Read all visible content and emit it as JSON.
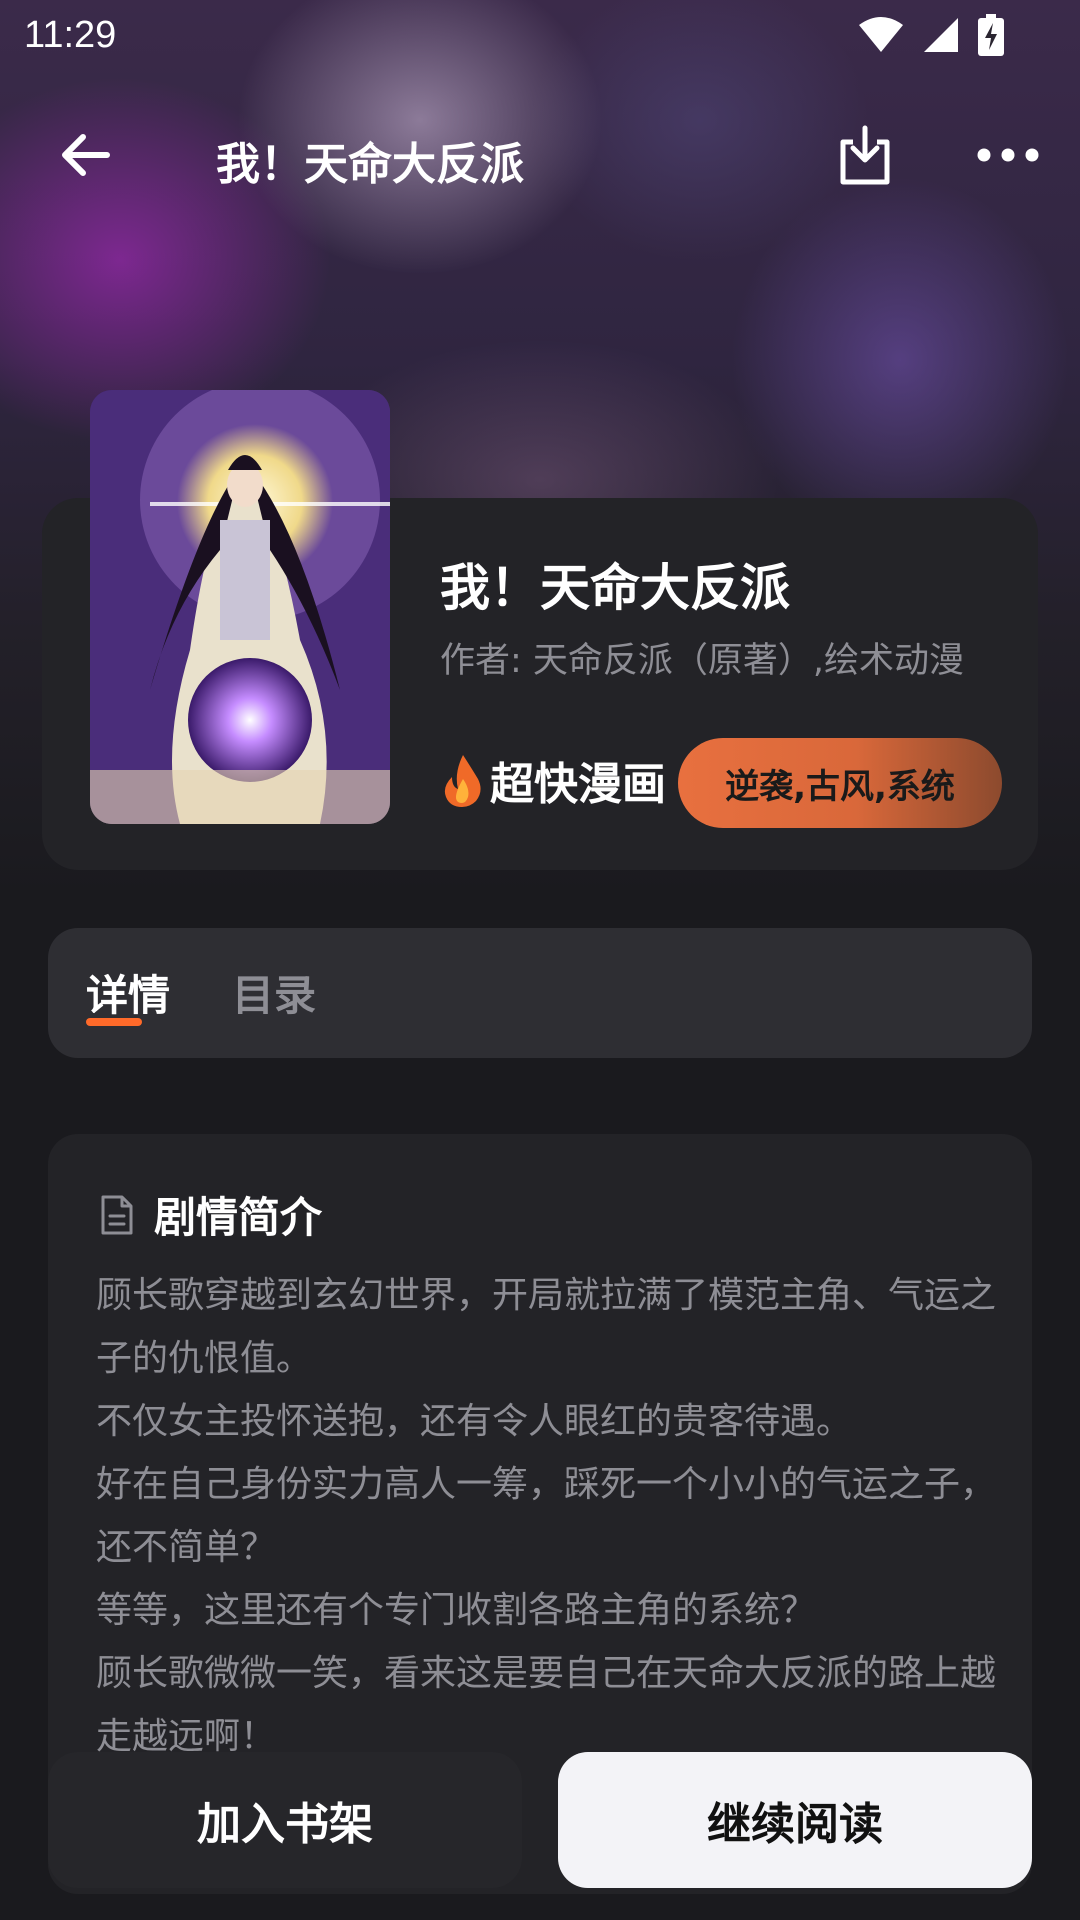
{
  "status_bar": {
    "time": "11:29"
  },
  "top_bar": {
    "title": "我！天命大反派"
  },
  "book": {
    "title": "我！天命大反派",
    "author": "作者: 天命反派（原著）,绘术动漫",
    "hot_label": "超快漫画",
    "tags": "逆袭,古风,系统"
  },
  "tabs": [
    {
      "label": "详情",
      "active": true
    },
    {
      "label": "目录",
      "active": false
    }
  ],
  "synopsis": {
    "title": "剧情简介",
    "paragraphs": [
      "顾长歌穿越到玄幻世界，开局就拉满了模范主角、气运之子的仇恨值。",
      "不仅女主投怀送抱，还有令人眼红的贵客待遇。",
      "好在自己身份实力高人一筹，踩死一个小小的气运之子，还不简单？",
      "等等，这里还有个专门收割各路主角的系统？",
      "顾长歌微微一笑，看来这是要自己在天命大反派的路上越走越远啊！"
    ]
  },
  "actions": {
    "add_to_shelf": "加入书架",
    "continue_reading": "继续阅读"
  },
  "colors": {
    "accent": "#ff6a2a",
    "background": "#1a1a1e",
    "card": "#232327"
  }
}
